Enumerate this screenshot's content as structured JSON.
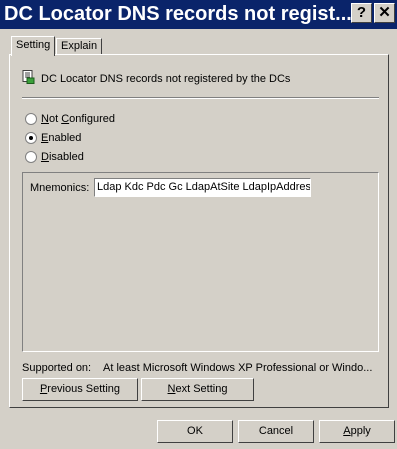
{
  "window": {
    "title": "DC Locator DNS records not regist...",
    "help_label": "?",
    "close_label": "✕"
  },
  "tabs": [
    {
      "label": "Setting"
    },
    {
      "label": "Explain"
    }
  ],
  "policy": {
    "name": "DC Locator DNS records not registered by the DCs",
    "icon": "policy-document-icon"
  },
  "options": [
    {
      "label": "Not Configured",
      "selected": false
    },
    {
      "label": "Enabled",
      "selected": true
    },
    {
      "label": "Disabled",
      "selected": false
    }
  ],
  "mnemonics": {
    "label": "Mnemonics:",
    "value": "Ldap Kdc Pdc Gc LdapAtSite LdapIpAddres"
  },
  "supported": {
    "label": "Supported on:",
    "value": "At least Microsoft Windows XP Professional or Windo..."
  },
  "nav": {
    "previous_label": "Previous Setting",
    "next_label": "Next Setting"
  },
  "dialog_buttons": {
    "ok_label": "OK",
    "cancel_label": "Cancel",
    "apply_label": "Apply"
  }
}
